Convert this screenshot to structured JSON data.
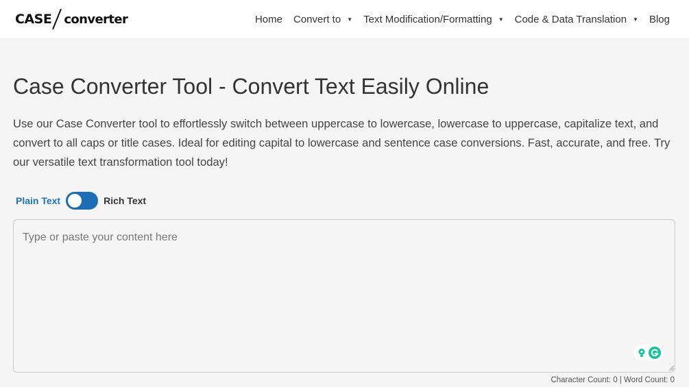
{
  "brand": {
    "left": "CASE",
    "right": "converter"
  },
  "nav": [
    {
      "label": "Home",
      "dropdown": false
    },
    {
      "label": "Convert to",
      "dropdown": true
    },
    {
      "label": "Text Modification/Formatting",
      "dropdown": true
    },
    {
      "label": "Code & Data Translation",
      "dropdown": true
    },
    {
      "label": "Blog",
      "dropdown": false
    }
  ],
  "page": {
    "title": "Case Converter Tool - Convert Text Easily Online",
    "description": "Use our Case Converter tool to effortlessly switch between uppercase to lowercase, lowercase to uppercase, capitalize text, and convert to all caps or title cases. Ideal for editing capital to lowercase and sentence case conversions. Fast, accurate, and free. Try our versatile text transformation tool today!"
  },
  "toggle": {
    "left_label": "Plain Text",
    "right_label": "Rich Text",
    "state": "plain"
  },
  "editor": {
    "value": "",
    "placeholder": "Type or paste your content here"
  },
  "counts": {
    "char_label": "Character Count:",
    "char_value": "0",
    "separator": "|",
    "word_label": "Word Count:",
    "word_value": "0"
  },
  "colors": {
    "accent": "#1b6db5",
    "link": "#1e73be",
    "grammarly": "#15c39a",
    "background": "#f5f5f5"
  },
  "icons": {
    "caret": "caret-down-icon",
    "bulb": "lightbulb-icon",
    "grammarly": "grammarly-icon"
  }
}
